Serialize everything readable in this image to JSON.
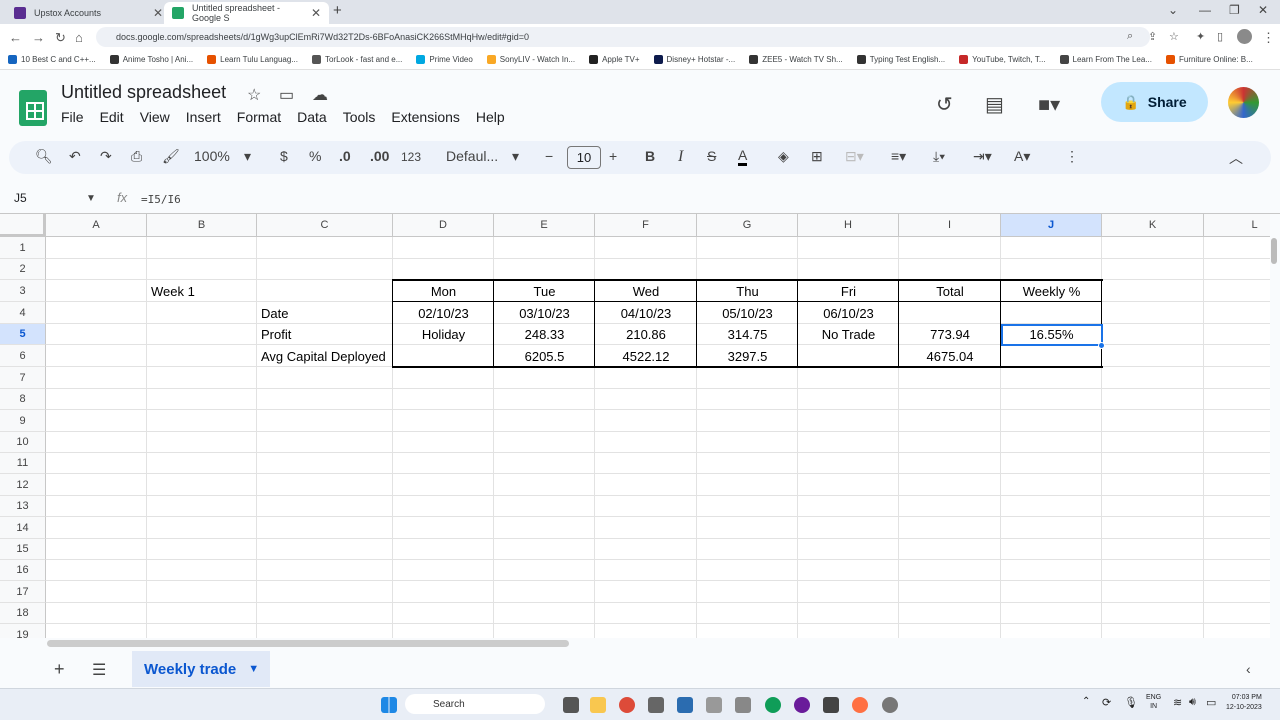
{
  "browser": {
    "tabs": [
      {
        "label": "Upstox Accounts",
        "color": "#5a2d91"
      },
      {
        "label": "Untitled spreadsheet - Google S",
        "color": "#23a566"
      }
    ],
    "new_tab_icon": "plus-icon",
    "url": "docs.google.com/spreadsheets/d/1gWg3upClEmRi7Wd32T2Ds-6BFoAnasiCK266StMHqHw/edit#gid=0",
    "bookmarks": [
      {
        "label": "10 Best C and C++...",
        "color": "#1565c0"
      },
      {
        "label": "Anime Tosho | Ani...",
        "color": "#333"
      },
      {
        "label": "Learn Tulu Languag...",
        "color": "#e65100"
      },
      {
        "label": "TorLook - fast and e...",
        "color": "#555"
      },
      {
        "label": "Prime Video",
        "color": "#00a8e1"
      },
      {
        "label": "SonyLIV - Watch In...",
        "color": "#f9a825"
      },
      {
        "label": "Apple TV+",
        "color": "#222"
      },
      {
        "label": "Disney+ Hotstar -...",
        "color": "#0d1b4c"
      },
      {
        "label": "ZEE5 - Watch TV Sh...",
        "color": "#333"
      },
      {
        "label": "Typing Test English...",
        "color": "#333"
      },
      {
        "label": "YouTube, Twitch, T...",
        "color": "#c62828"
      },
      {
        "label": "Learn From The Lea...",
        "color": "#444"
      },
      {
        "label": "Furniture Online: B...",
        "color": "#e65100"
      }
    ]
  },
  "doc": {
    "title": "Untitled spreadsheet",
    "menu": [
      "File",
      "Edit",
      "View",
      "Insert",
      "Format",
      "Data",
      "Tools",
      "Extensions",
      "Help"
    ],
    "share_label": "Share"
  },
  "toolbar": {
    "zoom": "100%",
    "currency": "$",
    "percent": "%",
    "dec_decrease": ".0",
    "dec_increase": ".00",
    "format_123": "123",
    "font": "Defaul...",
    "font_size": "10",
    "bold": "B",
    "italic": "I",
    "strike": "S",
    "text_color": "A",
    "text_color_value": "#000000"
  },
  "formula_bar": {
    "cell_ref": "J5",
    "fx": "fx",
    "formula": "=I5/I6"
  },
  "grid": {
    "columns": [
      "A",
      "B",
      "C",
      "D",
      "E",
      "F",
      "G",
      "H",
      "I",
      "J",
      "K",
      "L"
    ],
    "selected_column": "J",
    "rows": [
      "1",
      "2",
      "3",
      "4",
      "5",
      "6",
      "7",
      "8",
      "9",
      "10",
      "11",
      "12",
      "13",
      "14",
      "15",
      "16",
      "17",
      "18",
      "19"
    ],
    "selected_row": "5",
    "cells": {
      "B3": "Week 1",
      "C4": "Date",
      "C5": "Profit",
      "C6": "Avg Capital Deployed",
      "D3": "Mon",
      "E3": "Tue",
      "F3": "Wed",
      "G3": "Thu",
      "H3": "Fri",
      "I3": "Total",
      "J3": "Weekly %",
      "D4": "02/10/23",
      "E4": "03/10/23",
      "F4": "04/10/23",
      "G4": "05/10/23",
      "H4": "06/10/23",
      "D5": "Holiday",
      "E5": "248.33",
      "F5": "210.86",
      "G5": "314.75",
      "H5": "No Trade",
      "I5": "773.94",
      "J5": "16.55%",
      "E6": "6205.5",
      "F6": "4522.12",
      "G6": "3297.5",
      "I6": "4675.04"
    }
  },
  "sheets": {
    "active": "Weekly trade"
  },
  "taskbar": {
    "search_label": "Search",
    "lang_line1": "ENG",
    "lang_line2": "IN",
    "time": "07:03 PM",
    "date": "12-10-2023"
  }
}
